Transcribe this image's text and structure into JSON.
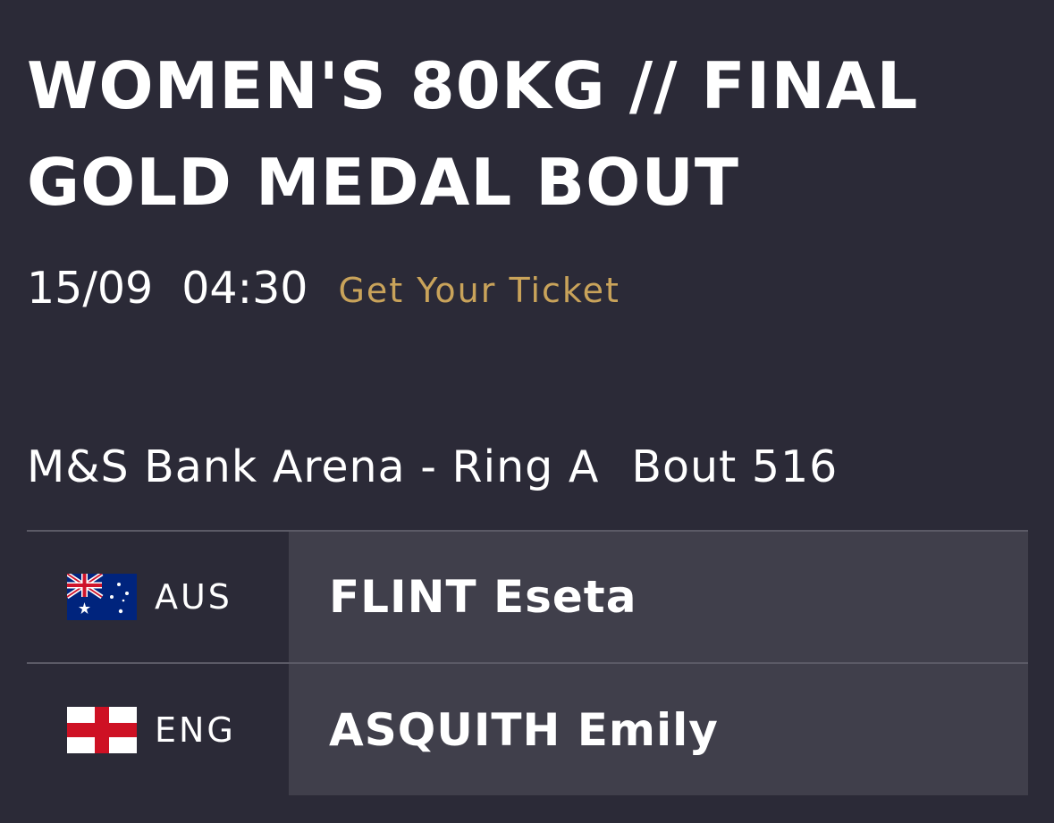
{
  "bout": {
    "title_line1": "WOMEN'S 80KG // FINAL",
    "title_line2": "GOLD MEDAL BOUT",
    "date": "15/09",
    "time": "04:30",
    "ticket_label": "Get Your Ticket",
    "venue": "M&S Bank Arena - Ring A",
    "bout_number": "Bout 516"
  },
  "competitors": [
    {
      "country_code": "AUS",
      "flag_icon": "australia-flag-icon",
      "name": "FLINT Eseta"
    },
    {
      "country_code": "ENG",
      "flag_icon": "england-flag-icon",
      "name": "ASQUITH Emily"
    }
  ],
  "colors": {
    "background": "#2b2a37",
    "name_cell": "#403f4b",
    "accent_link": "#c9a35a",
    "divider": "#5b5a66"
  }
}
